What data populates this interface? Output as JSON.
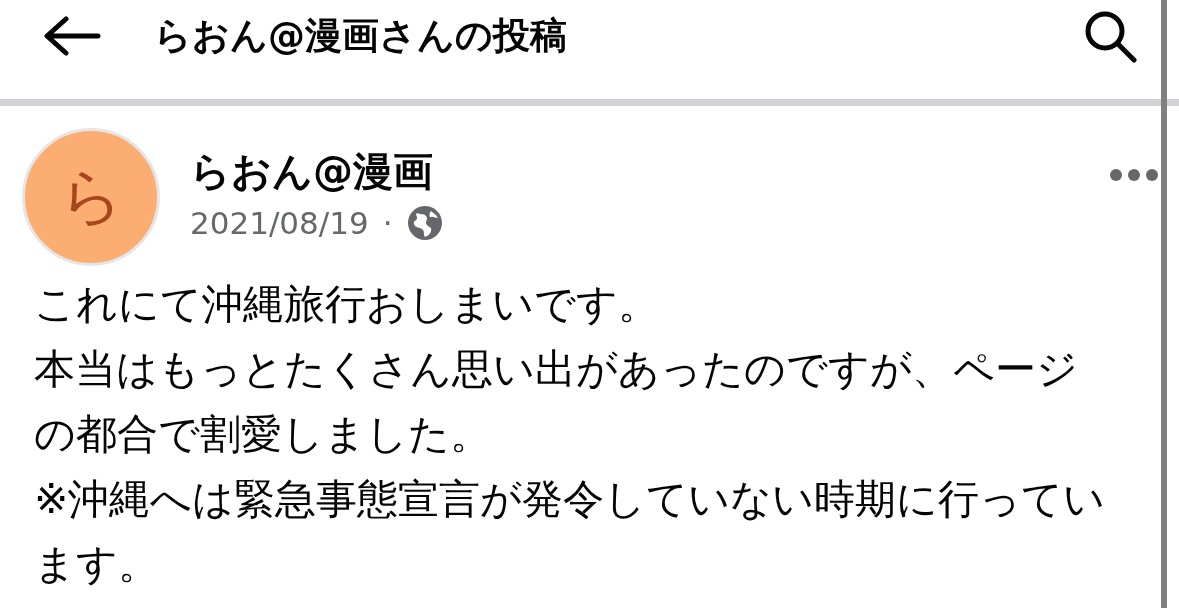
{
  "header": {
    "title": "らおん@漫画さんの投稿"
  },
  "post": {
    "avatar_letter": "ら",
    "author": "らおん@漫画",
    "date": "2021/08/19",
    "separator": "·",
    "body_lines": [
      "これにて沖縄旅行おしまいです。",
      "本当はもっとたくさん思い出があったのですが、ページ",
      "の都合で割愛しました。",
      "※沖縄へは緊急事態宣言が発令していない時期に行ってい",
      "ます。"
    ]
  }
}
